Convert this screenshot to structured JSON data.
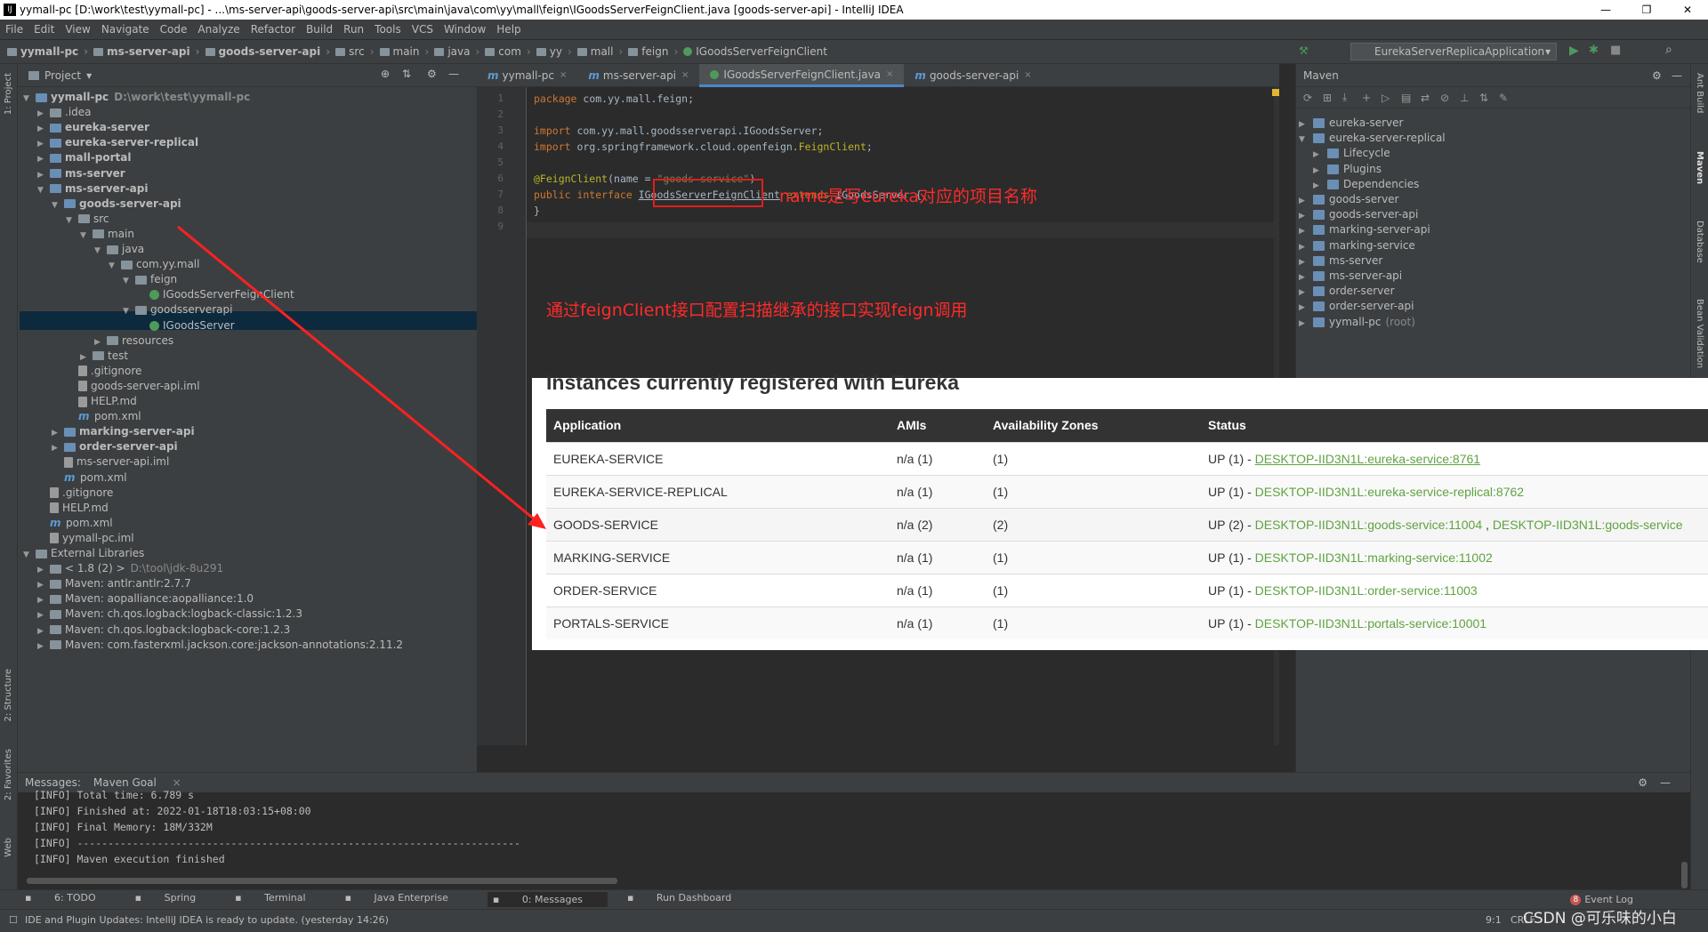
{
  "window": {
    "title": "yymall-pc [D:\\work\\test\\yymall-pc] - ...\\ms-server-api\\goods-server-api\\src\\main\\java\\com\\yy\\mall\\feign\\IGoodsServerFeignClient.java [goods-server-api] - IntelliJ IDEA",
    "controls": [
      "—",
      "❐",
      "✕"
    ]
  },
  "menu": [
    "File",
    "Edit",
    "View",
    "Navigate",
    "Code",
    "Analyze",
    "Refactor",
    "Build",
    "Run",
    "Tools",
    "VCS",
    "Window",
    "Help"
  ],
  "breadcrumbs": [
    "yymall-pc",
    "ms-server-api",
    "goods-server-api",
    "src",
    "main",
    "java",
    "com",
    "yy",
    "mall",
    "feign",
    "IGoodsServerFeignClient"
  ],
  "run_config": "EurekaServerReplicaApplication",
  "left_tool_labels": [
    "1: Project",
    "2: Structure",
    "2: Favorites",
    "Web"
  ],
  "right_tool_labels": [
    "Ant Build",
    "Maven",
    "Database",
    "Bean Validation"
  ],
  "project_panel": {
    "title": "Project",
    "rows": [
      {
        "label": "yymall-pc",
        "extra": "D:\\work\\test\\yymall-pc",
        "arrow": "▼",
        "icon": "module",
        "bold": true
      },
      {
        "label": ".idea",
        "arrow": "▶",
        "icon": "folder"
      },
      {
        "label": "eureka-server",
        "arrow": "▶",
        "icon": "module",
        "bold": true
      },
      {
        "label": "eureka-server-replical",
        "arrow": "▶",
        "icon": "module",
        "bold": true
      },
      {
        "label": "mall-portal",
        "arrow": "▶",
        "icon": "module",
        "bold": true
      },
      {
        "label": "ms-server",
        "arrow": "▶",
        "icon": "module",
        "bold": true
      },
      {
        "label": "ms-server-api",
        "arrow": "▼",
        "icon": "module",
        "bold": true
      },
      {
        "label": "goods-server-api",
        "arrow": "▼",
        "icon": "module",
        "bold": true
      },
      {
        "label": "src",
        "arrow": "▼",
        "icon": "folder"
      },
      {
        "label": "main",
        "arrow": "▼",
        "icon": "folder"
      },
      {
        "label": "java",
        "arrow": "▼",
        "icon": "folder"
      },
      {
        "label": "com.yy.mall",
        "arrow": "▼",
        "icon": "folder"
      },
      {
        "label": "feign",
        "arrow": "▼",
        "icon": "folder"
      },
      {
        "label": "IGoodsServerFeignClient",
        "arrow": "",
        "icon": "java"
      },
      {
        "label": "goodsserverapi",
        "arrow": "▼",
        "icon": "folder"
      },
      {
        "label": "IGoodsServer",
        "arrow": "",
        "icon": "java"
      },
      {
        "label": "resources",
        "arrow": "▶",
        "icon": "folder"
      },
      {
        "label": "test",
        "arrow": "▶",
        "icon": "folder"
      },
      {
        "label": ".gitignore",
        "arrow": "",
        "icon": "file"
      },
      {
        "label": "goods-server-api.iml",
        "arrow": "",
        "icon": "file"
      },
      {
        "label": "HELP.md",
        "arrow": "",
        "icon": "file"
      },
      {
        "label": "pom.xml",
        "arrow": "",
        "icon": "m"
      },
      {
        "label": "marking-server-api",
        "arrow": "▶",
        "icon": "module",
        "bold": true
      },
      {
        "label": "order-server-api",
        "arrow": "▶",
        "icon": "module",
        "bold": true
      },
      {
        "label": "ms-server-api.iml",
        "arrow": "",
        "icon": "file"
      },
      {
        "label": "pom.xml",
        "arrow": "",
        "icon": "m"
      },
      {
        "label": ".gitignore",
        "arrow": "",
        "icon": "file"
      },
      {
        "label": "HELP.md",
        "arrow": "",
        "icon": "file"
      },
      {
        "label": "pom.xml",
        "arrow": "",
        "icon": "m"
      },
      {
        "label": "yymall-pc.iml",
        "arrow": "",
        "icon": "file"
      },
      {
        "label": "External Libraries",
        "arrow": "▼",
        "icon": "folder"
      },
      {
        "label": "< 1.8 (2) >",
        "extra": "D:\\tool\\jdk-8u291",
        "arrow": "▶",
        "icon": "folder"
      },
      {
        "label": "Maven: antlr:antlr:2.7.7",
        "arrow": "▶",
        "icon": "folder"
      },
      {
        "label": "Maven: aopalliance:aopalliance:1.0",
        "arrow": "▶",
        "icon": "folder"
      },
      {
        "label": "Maven: ch.qos.logback:logback-classic:1.2.3",
        "arrow": "▶",
        "icon": "folder"
      },
      {
        "label": "Maven: ch.qos.logback:logback-core:1.2.3",
        "arrow": "▶",
        "icon": "folder"
      },
      {
        "label": "Maven: com.fasterxml.jackson.core:jackson-annotations:2.11.2",
        "arrow": "▶",
        "icon": "folder"
      }
    ]
  },
  "editor_tabs": [
    {
      "label": "yymall-pc",
      "icon": "m"
    },
    {
      "label": "ms-server-api",
      "icon": "m"
    },
    {
      "label": "IGoodsServerFeignClient.java",
      "icon": "java",
      "active": true
    },
    {
      "label": "goods-server-api",
      "icon": "m"
    }
  ],
  "code_lines": [
    {
      "n": "1",
      "html_parts": [
        [
          "kw",
          "package "
        ],
        [
          "ig",
          "com.yy.mall.feign;"
        ]
      ]
    },
    {
      "n": "2",
      "html_parts": []
    },
    {
      "n": "3",
      "html_parts": [
        [
          "kw",
          "import "
        ],
        [
          "ig",
          "com.yy.mall.goodsserverapi.IGoodsServer;"
        ]
      ]
    },
    {
      "n": "4",
      "html_parts": [
        [
          "kw",
          "import "
        ],
        [
          "ig",
          "org.springframework.cloud.openfeign."
        ],
        [
          "an",
          "FeignClient"
        ],
        [
          "ig",
          ";"
        ]
      ]
    },
    {
      "n": "5",
      "html_parts": []
    },
    {
      "n": "6",
      "html_parts": [
        [
          "an",
          "@FeignClient"
        ],
        [
          "ig",
          "(name = "
        ],
        [
          "str",
          "\"goods-service\""
        ],
        [
          "ig",
          ")"
        ]
      ]
    },
    {
      "n": "7",
      "html_parts": [
        [
          "kw",
          "public interface "
        ],
        [
          "ty",
          "IGoodsServerFeignClient"
        ],
        [
          "kw",
          " extends "
        ],
        [
          "ig",
          "IGoodsServer {"
        ]
      ]
    },
    {
      "n": "8",
      "html_parts": [
        [
          "ig",
          "}"
        ]
      ]
    },
    {
      "n": "9",
      "html_parts": []
    }
  ],
  "annotations": {
    "name_note": "name是写eureka对应的项目名称",
    "feign_note": "通过feignClient接口配置扫描继承的接口实现feign调用"
  },
  "maven": {
    "title": "Maven",
    "rows": [
      {
        "label": "eureka-server",
        "arrow": "▶",
        "indent": 0
      },
      {
        "label": "eureka-server-replical",
        "arrow": "▼",
        "indent": 0
      },
      {
        "label": "Lifecycle",
        "arrow": "▶",
        "indent": 1
      },
      {
        "label": "Plugins",
        "arrow": "▶",
        "indent": 1
      },
      {
        "label": "Dependencies",
        "arrow": "▶",
        "indent": 1
      },
      {
        "label": "goods-server",
        "arrow": "▶",
        "indent": 0
      },
      {
        "label": "goods-server-api",
        "arrow": "▶",
        "indent": 0
      },
      {
        "label": "marking-server-api",
        "arrow": "▶",
        "indent": 0
      },
      {
        "label": "marking-service",
        "arrow": "▶",
        "indent": 0
      },
      {
        "label": "ms-server",
        "arrow": "▶",
        "indent": 0
      },
      {
        "label": "ms-server-api",
        "arrow": "▶",
        "indent": 0
      },
      {
        "label": "order-server",
        "arrow": "▶",
        "indent": 0
      },
      {
        "label": "order-server-api",
        "arrow": "▶",
        "indent": 0
      },
      {
        "label": "yymall-pc",
        "extra": "(root)",
        "arrow": "▶",
        "indent": 0
      }
    ]
  },
  "eureka": {
    "heading": "Instances currently registered with Eureka",
    "columns": [
      "Application",
      "AMIs",
      "Availability Zones",
      "Status"
    ],
    "rows": [
      {
        "app": "EUREKA-SERVICE",
        "amis": "n/a (1)",
        "zones": "(1)",
        "status": "UP (1) - ",
        "links": [
          "DESKTOP-IID3N1L:eureka-service:8761"
        ],
        "underline": true
      },
      {
        "app": "EUREKA-SERVICE-REPLICAL",
        "amis": "n/a (1)",
        "zones": "(1)",
        "status": "UP (1) - ",
        "links": [
          "DESKTOP-IID3N1L:eureka-service-replical:8762"
        ]
      },
      {
        "app": "GOODS-SERVICE",
        "amis": "n/a (2)",
        "zones": "(2)",
        "status": "UP (2) - ",
        "links": [
          "DESKTOP-IID3N1L:goods-service:11004",
          "DESKTOP-IID3N1L:goods-service"
        ]
      },
      {
        "app": "MARKING-SERVICE",
        "amis": "n/a (1)",
        "zones": "(1)",
        "status": "UP (1) - ",
        "links": [
          "DESKTOP-IID3N1L:marking-service:11002"
        ]
      },
      {
        "app": "ORDER-SERVICE",
        "amis": "n/a (1)",
        "zones": "(1)",
        "status": "UP (1) - ",
        "links": [
          "DESKTOP-IID3N1L:order-service:11003"
        ]
      },
      {
        "app": "PORTALS-SERVICE",
        "amis": "n/a (1)",
        "zones": "(1)",
        "status": "UP (1) - ",
        "links": [
          "DESKTOP-IID3N1L:portals-service:10001"
        ]
      }
    ]
  },
  "messages": {
    "tabs": [
      "Messages:",
      "Maven Goal"
    ],
    "lines": [
      "[INFO] Total time: 6.789 s",
      "[INFO] Finished at: 2022-01-18T18:03:15+08:00",
      "[INFO] Final Memory: 18M/332M",
      "[INFO] ------------------------------------------------------------------------",
      "[INFO] Maven execution finished"
    ]
  },
  "tool_windows": [
    "6: TODO",
    "Spring",
    "Terminal",
    "Java Enterprise",
    "0: Messages",
    "Run Dashboard"
  ],
  "event_log": {
    "count": "8",
    "label": "Event Log"
  },
  "status": {
    "message": "IDE and Plugin Updates: IntelliJ IDEA is ready to update. (yesterday 14:26)",
    "position": "9:1",
    "encoding": "CRLF",
    "watermark": "CSDN @可乐味的小白"
  }
}
